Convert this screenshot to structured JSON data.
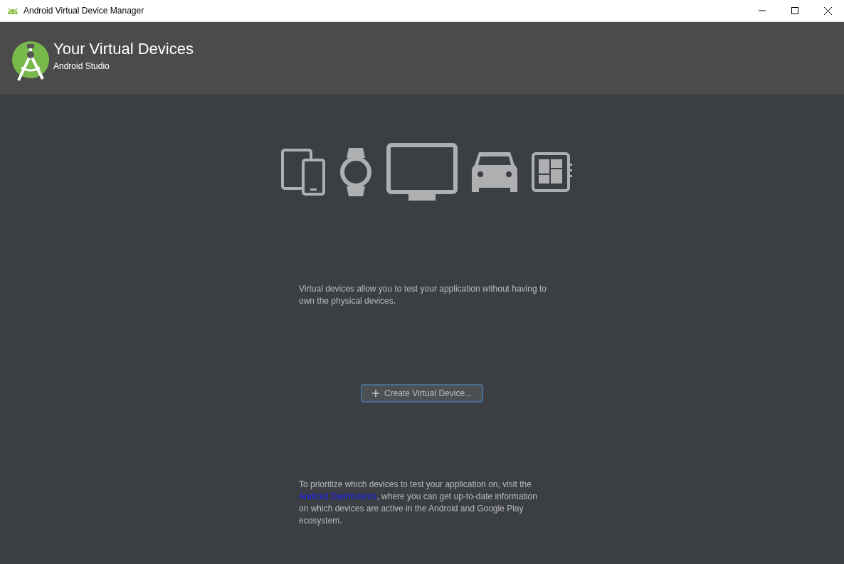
{
  "window": {
    "title": "Android Virtual Device Manager"
  },
  "header": {
    "title": "Your Virtual Devices",
    "subtitle": "Android Studio"
  },
  "intro": "Virtual devices allow you to test your application without having to own the physical devices.",
  "create_button": {
    "label": "Create Virtual Device...",
    "focused": true
  },
  "footer": {
    "before": "To prioritize which devices to test your application on, visit the ",
    "link": "Android Dashboards",
    "after": ", where you can get up-to-date information on which devices are active in the Android and Google Play ecosystem."
  }
}
